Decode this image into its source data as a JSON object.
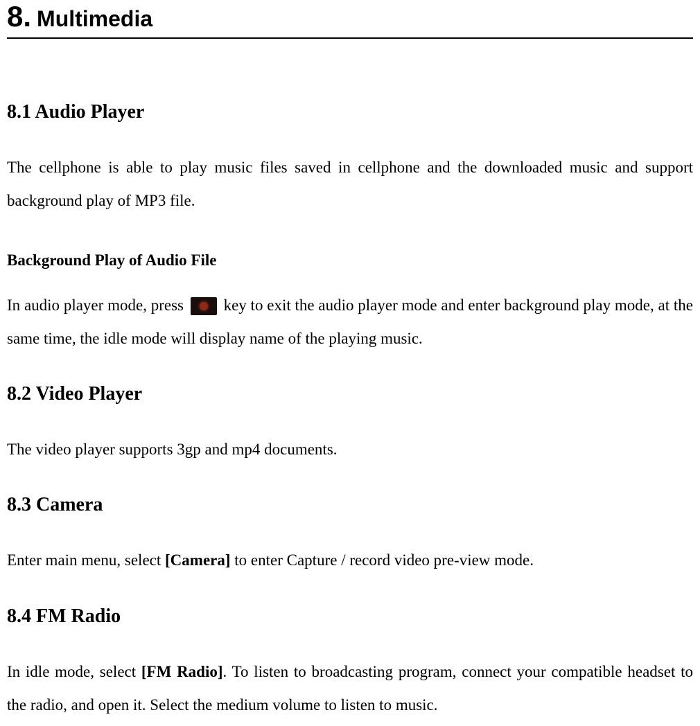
{
  "chapter": {
    "number": "8.",
    "title": "Multimedia"
  },
  "sections": {
    "s81": {
      "heading": "8.1  Audio Player",
      "para1": "The cellphone is able to play music files saved in cellphone and the downloaded music and support background play of MP3 file.",
      "subheading": "Background Play of Audio File",
      "para2_run1": "In audio player mode, press ",
      "para2_run2": " key to exit the audio player mode and enter background play mode, at the same time, the idle mode will display name of the playing music."
    },
    "s82": {
      "heading": "8.2  Video Player",
      "para": "The video player supports 3gp and mp4 documents."
    },
    "s83": {
      "heading": "8.3  Camera",
      "para_run1": "Enter main menu, select ",
      "para_bold": "[Camera]",
      "para_run2": " to enter Capture / record video pre-view mode."
    },
    "s84": {
      "heading": "8.4  FM Radio",
      "para_run1": "In idle mode, select ",
      "para_bold": "[FM Radio]",
      "para_run2": ". To listen to broadcasting program, connect your compatible headset to the radio, and open it. Select the medium volume to listen to music."
    }
  }
}
